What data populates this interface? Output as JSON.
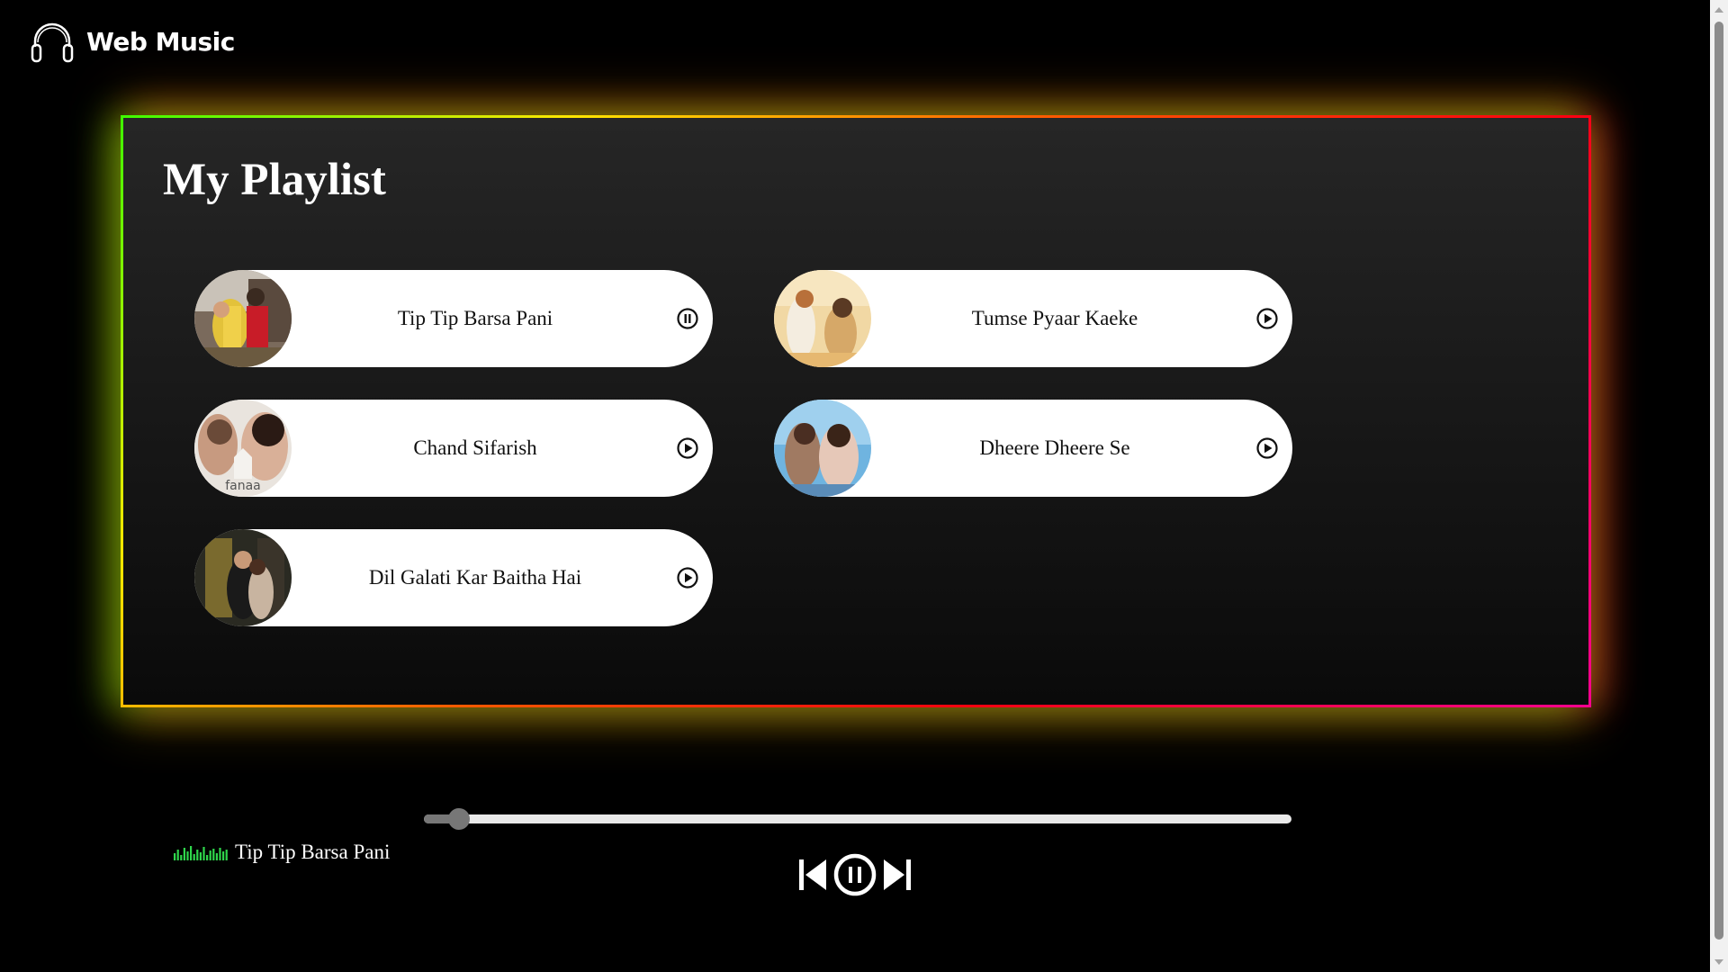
{
  "app": {
    "title": "Web Music",
    "logo_icon": "headphones-icon"
  },
  "playlist": {
    "heading": "My Playlist",
    "songs": [
      {
        "title": "Tip Tip Barsa Pani",
        "state": "playing",
        "control_icon": "pause-circle-icon"
      },
      {
        "title": "Tumse Pyaar Kaeke",
        "state": "stopped",
        "control_icon": "play-circle-icon"
      },
      {
        "title": "Chand Sifarish",
        "state": "stopped",
        "control_icon": "play-circle-icon",
        "thumbnail_text": "fanaa"
      },
      {
        "title": "Dheere Dheere Se",
        "state": "stopped",
        "control_icon": "play-circle-icon"
      },
      {
        "title": "Dil Galati Kar Baitha Hai",
        "state": "stopped",
        "control_icon": "play-circle-icon"
      }
    ]
  },
  "player": {
    "now_playing": "Tip Tip Barsa Pani",
    "progress_fraction": 0.04,
    "controls": {
      "previous_icon": "skip-previous-icon",
      "pause_icon": "pause-circle-icon",
      "next_icon": "skip-next-icon"
    }
  },
  "colors": {
    "background": "#000000",
    "card": "#ffffff",
    "frame_gradient": [
      "#3dff00",
      "#ffe600",
      "#ff5a00",
      "#ff0010",
      "#ff0090"
    ],
    "equalizer": "#2fd64b",
    "progress_track": "#e9e9e9",
    "progress_fill": "#777777"
  }
}
